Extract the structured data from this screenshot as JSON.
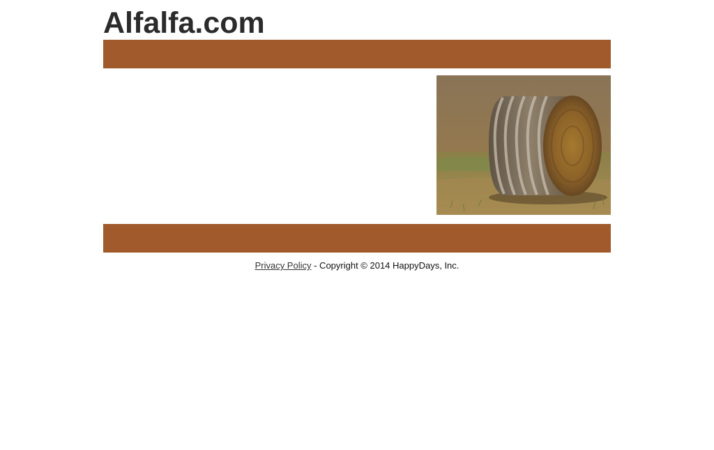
{
  "site": {
    "title": "Alfalfa.com"
  },
  "colors": {
    "bar": "#a05a2c"
  },
  "hero_image": {
    "icon": "hay-bale-photo"
  },
  "footer": {
    "privacy_link": "Privacy Policy",
    "copyright": " - Copyright © 2014 HappyDays, Inc."
  }
}
